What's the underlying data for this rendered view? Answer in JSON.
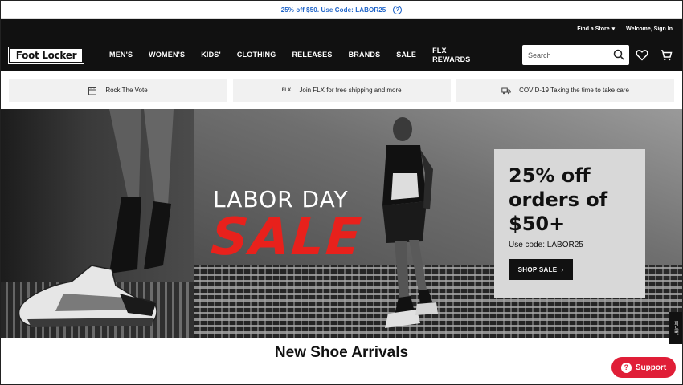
{
  "promo": {
    "text": "25% off $50. Use Code: LABOR25",
    "help_icon": "?"
  },
  "utility": {
    "find_store": "Find a Store",
    "welcome": "Welcome, Sign In"
  },
  "nav": {
    "logo": "Foot Locker",
    "items": [
      "MEN'S",
      "WOMEN'S",
      "KIDS'",
      "CLOTHING",
      "RELEASES",
      "BRANDS",
      "SALE",
      "FLX REWARDS"
    ],
    "search_placeholder": "Search"
  },
  "info_cards": [
    {
      "icon": "calendar-icon",
      "label": "Rock The Vote"
    },
    {
      "icon": "flx-icon",
      "icon_text": "FLX",
      "label": "Join FLX for free shipping and more"
    },
    {
      "icon": "truck-icon",
      "label": "COVID-19 Taking the time to take care"
    }
  ],
  "hero": {
    "line1": "LABOR DAY",
    "line2": "SALE",
    "offer_title": "25% off orders of $50+",
    "offer_code": "Use code: LABOR25",
    "cta": "SHOP SALE"
  },
  "side_tab": "피드백",
  "arrivals_title": "New Shoe Arrivals",
  "support_label": "Support",
  "colors": {
    "sale_red": "#e8211c",
    "promo_blue": "#1f64c8",
    "support_red": "#e01e37",
    "nav_bg": "#111111"
  }
}
